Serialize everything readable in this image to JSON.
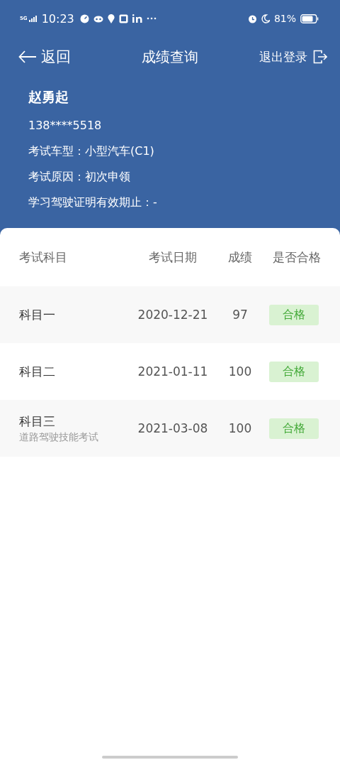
{
  "status_bar": {
    "network": "5G",
    "time": "10:23",
    "battery_text": "81%"
  },
  "nav": {
    "back": "返回",
    "title": "成绩查询",
    "logout": "退出登录"
  },
  "profile": {
    "name": "赵勇起",
    "phone": "138****5518",
    "lines": [
      "考试车型：小型汽车(C1)",
      "考试原因：初次申领",
      "学习驾驶证明有效期止：-"
    ]
  },
  "table": {
    "columns": [
      "考试科目",
      "考试日期",
      "成绩",
      "是否合格"
    ],
    "rows": [
      {
        "subject": "科目一",
        "date": "2020-12-21",
        "score": "97",
        "result": "合格",
        "passed": true
      },
      {
        "subject": "科目二",
        "date": "2021-01-11",
        "score": "100",
        "result": "合格",
        "passed": true
      },
      {
        "subject": "科目三",
        "note": "道路驾驶技能考试",
        "date": "2021-03-08",
        "score": "100",
        "result": "合格",
        "passed": true
      }
    ]
  }
}
